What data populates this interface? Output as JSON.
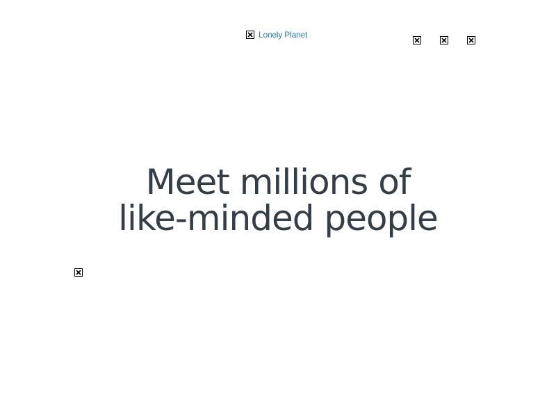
{
  "header": {
    "brand_text": "Lonely Planet",
    "brand_color": "#2a7ab7",
    "icons": [
      "broken-image-icon",
      "broken-image-icon",
      "broken-image-icon"
    ]
  },
  "hero": {
    "headline_line1": "Meet millions of",
    "headline_line2": "like-minded people",
    "text_color": "#333e48"
  }
}
